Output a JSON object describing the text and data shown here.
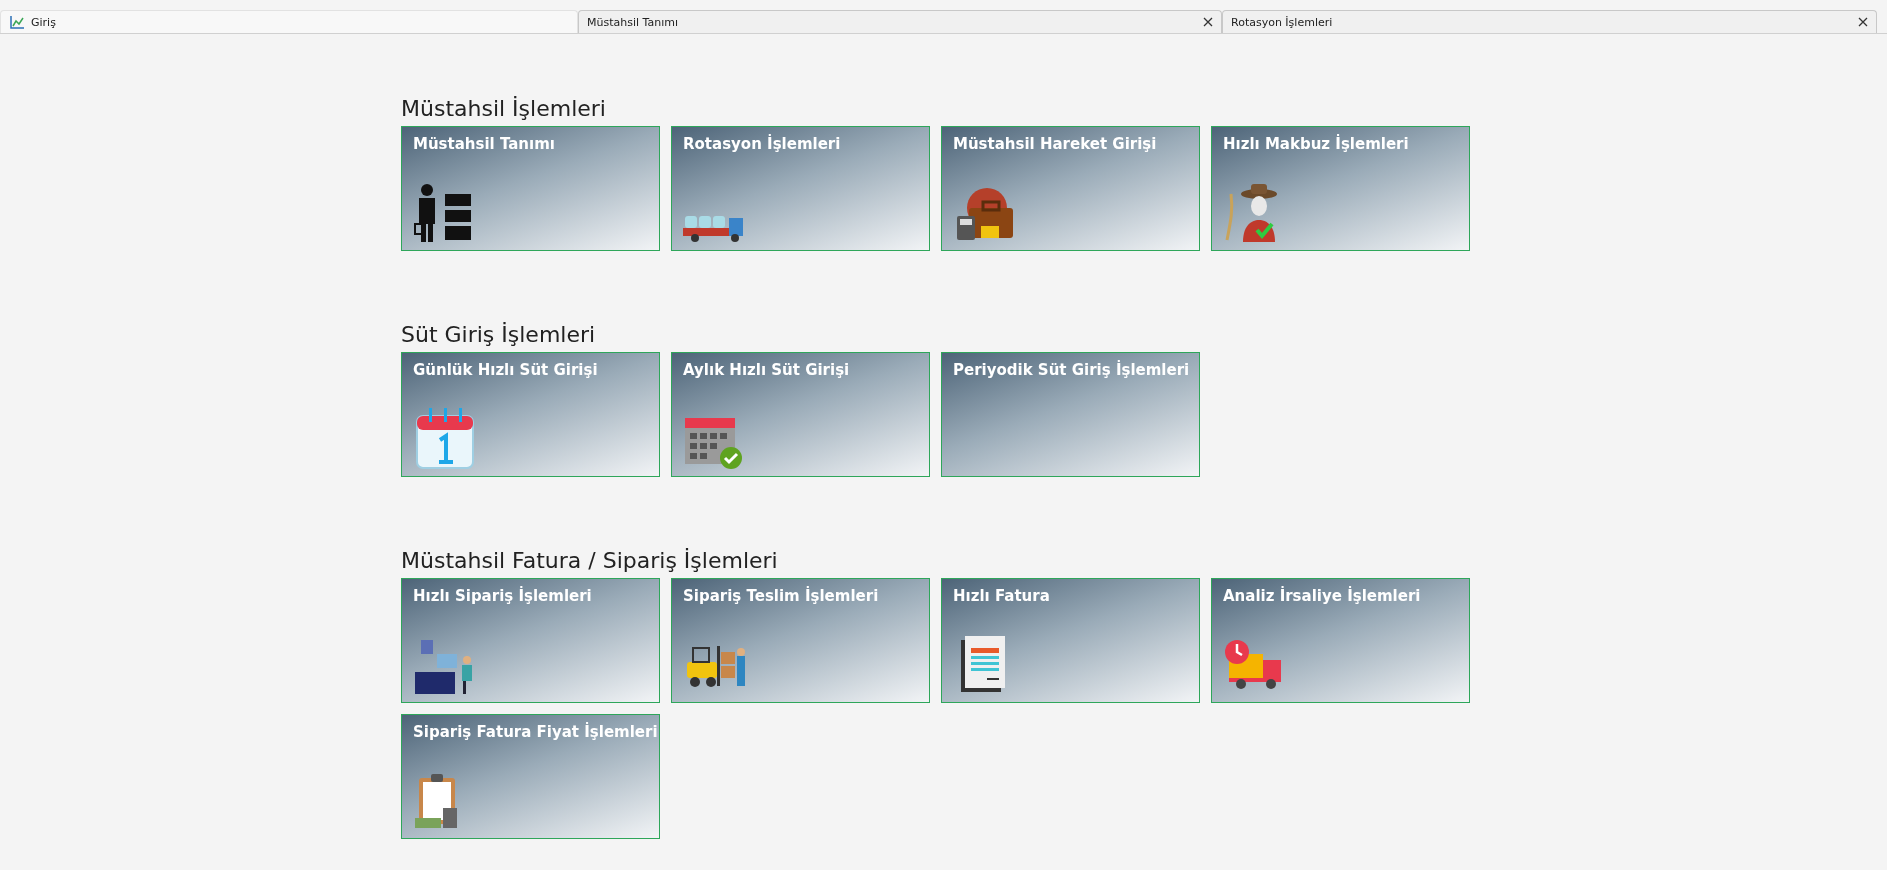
{
  "tabs": [
    {
      "label": "Giriş",
      "selected": true
    },
    {
      "label": "Müstahsil Tanımı",
      "selected": false
    },
    {
      "label": "Rotasyon İşlemleri",
      "selected": false
    }
  ],
  "sections": [
    {
      "title": "Müstahsil İşlemleri",
      "tiles": [
        {
          "label": "Müstahsil Tanımı",
          "kind": "worker"
        },
        {
          "label": "Rotasyon İşlemleri",
          "kind": "truck"
        },
        {
          "label": "Müstahsil Hareket Girişi",
          "kind": "briefcase"
        },
        {
          "label": "Hızlı Makbuz İşlemleri",
          "kind": "farmer"
        }
      ]
    },
    {
      "title": "Süt Giriş İşlemleri",
      "tiles": [
        {
          "label": "Günlük Hızlı Süt Girişi",
          "kind": "calendar-day"
        },
        {
          "label": "Aylık Hızlı Süt Girişi",
          "kind": "calendar-check"
        },
        {
          "label": "Periyodik Süt Giriş İşlemleri",
          "kind": "plain"
        }
      ]
    },
    {
      "title": "Müstahsil Fatura / Sipariş İşlemleri",
      "tiles": [
        {
          "label": "Hızlı Sipariş İşlemleri",
          "kind": "office"
        },
        {
          "label": "Sipariş Teslim İşlemleri",
          "kind": "forklift"
        },
        {
          "label": "Hızlı Fatura",
          "kind": "invoice"
        },
        {
          "label": "Analiz İrsaliye İşlemleri",
          "kind": "delivery"
        },
        {
          "label": "Sipariş Fatura Fiyat İşlemleri",
          "kind": "clipboard"
        }
      ]
    }
  ]
}
